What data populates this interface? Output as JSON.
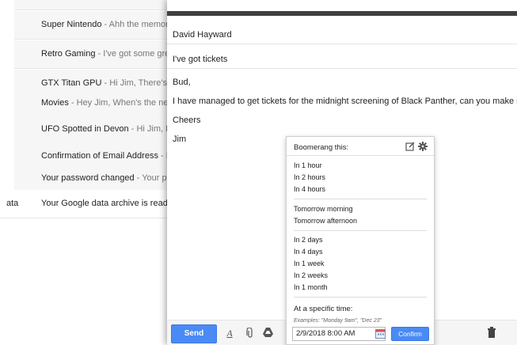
{
  "inbox": {
    "rows": [
      {
        "subject": "Super Nintendo",
        "snippet": " - Ahh the memories"
      },
      {
        "subject": "Retro Gaming",
        "snippet": " - I've got some great"
      },
      {
        "subject": "GTX Titan GPU",
        "snippet": " - Hi Jim, There's a g"
      },
      {
        "subject": "Movies",
        "snippet": " - Hey Jim, When's the next M"
      },
      {
        "subject": "UFO Spotted in Devon",
        "snippet": " - Hi Jim, Did"
      },
      {
        "subject": "Confirmation of Email Address",
        "snippet": " - Hi, a"
      },
      {
        "subject": "Your password changed",
        "snippet": " - Your pass"
      }
    ],
    "last_row": {
      "tag": "ata",
      "subject": "Your Google data archive is ready",
      "snippet": " - Y"
    }
  },
  "compose": {
    "to": "David Hayward",
    "subject": "I've got tickets",
    "body": [
      "Bud,",
      "I have managed to get tickets for the midnight screening of Black Panther, can you make it?",
      "Cheers",
      "Jim"
    ],
    "send_label": "Send"
  },
  "boomerang": {
    "title": "Boomerang this:",
    "group1": [
      "In 1 hour",
      "In 2 hours",
      "In 4 hours"
    ],
    "group2": [
      "Tomorrow morning",
      "Tomorrow afternoon"
    ],
    "group3": [
      "In 2 days",
      "In 4 days",
      "In 1 week",
      "In 2 weeks",
      "In 1 month"
    ],
    "specific_label": "At a specific time:",
    "examples": "Examples: \"Monday 9am\", \"Dec 23\"",
    "date_value": "2/9/2018 8:00 AM",
    "confirm_label": "Confirm"
  },
  "colors": {
    "accent": "#4a8af4",
    "topbar": "#404040"
  }
}
